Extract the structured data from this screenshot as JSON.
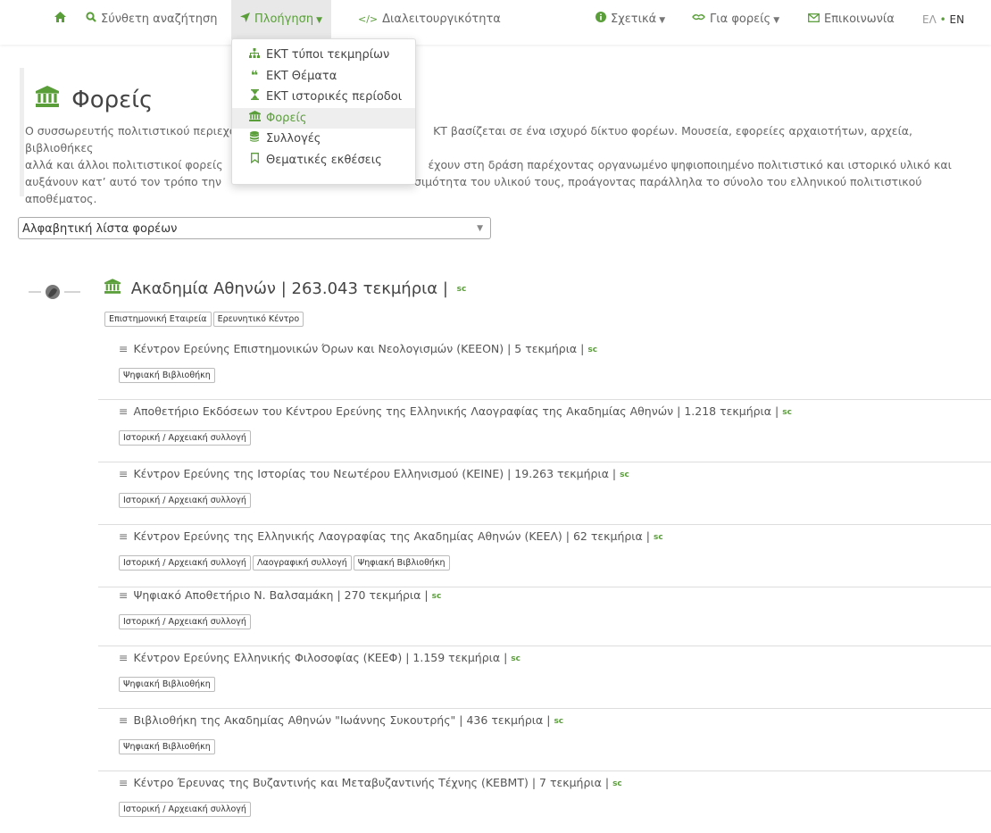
{
  "nav": {
    "home_icon": "home-icon",
    "search": "Σύνθετη αναζήτηση",
    "browse": "Πλοήγηση",
    "interop": "Διαλειτουργικότητα",
    "about": "Σχετικά",
    "for_providers": "Για φορείς",
    "contact": "Επικοινωνία",
    "lang_el": "ΕΛ",
    "lang_sep": "•",
    "lang_en": "EN"
  },
  "dropdown": {
    "items": [
      {
        "label": "ΕΚΤ τύποι τεκμηρίων",
        "icon": "sitemap-icon"
      },
      {
        "label": "ΕΚΤ Θέματα",
        "icon": "quote-icon"
      },
      {
        "label": "ΕΚΤ ιστορικές περίοδοι",
        "icon": "hourglass-icon"
      },
      {
        "label": "Φορείς",
        "icon": "institution-icon"
      },
      {
        "label": "Συλλογές",
        "icon": "database-icon"
      },
      {
        "label": "Θεματικές εκθέσεις",
        "icon": "bookmark-icon"
      }
    ]
  },
  "page": {
    "title": "Φορείς",
    "intro_line1": "Ο συσσωρευτής πολιτιστικού περιεχομένου",
    "intro_line1b": "ΚΤ βασίζεται σε ένα ισχυρό δίκτυο φορέων. Μουσεία, εφορείες αρχαιοτήτων, αρχεία, βιβλιοθήκες",
    "intro_line2": "αλλά και άλλοι πολιτιστικοί φορείς",
    "intro_line2b": "έχουν στη δράση παρέχοντας οργανωμένο ψηφιοποιημένο πολιτιστικό και ιστορικό υλικό και",
    "intro_line3": "αυξάνουν κατ’ αυτό τον τρόπο την",
    "intro_line3b": "σιμότητα του υλικού τους, προάγοντας παράλληλα το σύνολο του ελληνικού πολιτιστικού",
    "intro_line4": "αποθέματος."
  },
  "select": {
    "value": "Αλφαβητική λίστα φορέων"
  },
  "org": {
    "name": "Ακαδημία Αθηνών",
    "count": "| 263.043 τεκμήρια |",
    "sc": "sc",
    "tags": [
      "Επιστημονική Εταιρεία",
      "Ερευνητικό Κέντρο"
    ]
  },
  "collections": [
    {
      "name": "Κέντρον Ερεύνης Επιστημονικών Όρων και Νεολογισμών (ΚΕΕΟΝ)",
      "count": "| 5 τεκμήρια |",
      "tags": [
        "Ψηφιακή Βιβλιοθήκη"
      ]
    },
    {
      "name": "Αποθετήριο Εκδόσεων του Κέντρου Ερεύνης της Ελληνικής Λαογραφίας της Ακαδημίας Αθηνών",
      "count": "| 1.218 τεκμήρια |",
      "tags": [
        "Ιστορική / Αρχειακή συλλογή"
      ]
    },
    {
      "name": "Κέντρον Ερεύνης της Ιστορίας του Νεωτέρου Ελληνισμού (ΚΕΙΝΕ)",
      "count": "| 19.263 τεκμήρια |",
      "tags": [
        "Ιστορική / Αρχειακή συλλογή"
      ]
    },
    {
      "name": "Κέντρον Ερεύνης της Ελληνικής Λαογραφίας της Ακαδημίας Αθηνών (ΚΕΕΛ)",
      "count": "| 62 τεκμήρια |",
      "tags": [
        "Ιστορική / Αρχειακή συλλογή",
        "Λαογραφική συλλογή",
        "Ψηφιακή Βιβλιοθήκη"
      ]
    },
    {
      "name": "Ψηφιακό Αποθετήριο Ν. Βαλσαμάκη",
      "count": "| 270 τεκμήρια |",
      "tags": [
        "Ιστορική / Αρχειακή συλλογή"
      ]
    },
    {
      "name": "Κέντρον Ερεύνης Ελληνικής Φιλοσοφίας (ΚΕΕΦ)",
      "count": "| 1.159 τεκμήρια |",
      "tags": [
        "Ψηφιακή Βιβλιοθήκη"
      ]
    },
    {
      "name": "Βιβλιοθήκη της Ακαδημίας Αθηνών \"Ιωάννης Συκουτρής\"",
      "count": "| 436 τεκμήρια |",
      "tags": [
        "Ψηφιακή Βιβλιοθήκη"
      ]
    },
    {
      "name": "Κέντρο Έρευνας της Βυζαντινής και Μεταβυζαντινής Τέχνης (ΚΕΒΜΤ)",
      "count": "| 7 τεκμήρια |",
      "tags": [
        "Ιστορική / Αρχειακή συλλογή"
      ]
    }
  ],
  "colors": {
    "accent": "#5a9e3a",
    "text": "#444444",
    "muted": "#666666"
  }
}
